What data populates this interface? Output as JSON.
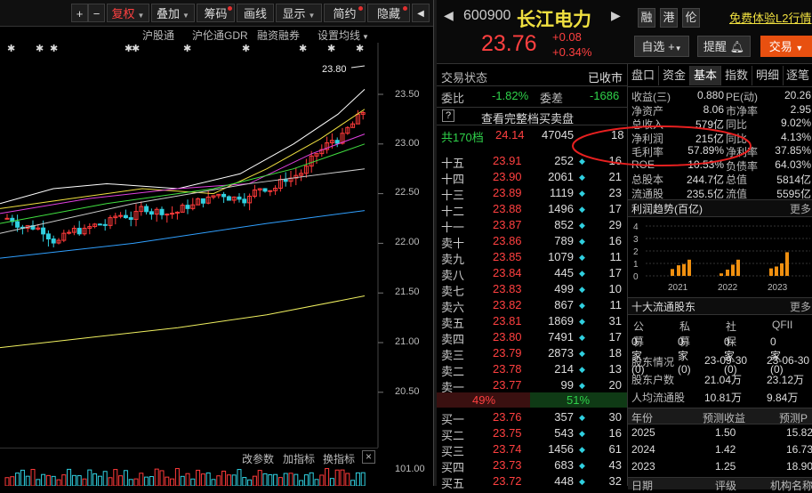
{
  "toolbar": {
    "items": [
      "+",
      "−",
      "复权",
      "叠加",
      "筹码",
      "画线",
      "显示",
      "简约",
      "隐藏"
    ],
    "close": "◀"
  },
  "subbar": {
    "items": [
      "沪股通",
      "沪伦通GDR",
      "融资融券",
      "设置均线"
    ]
  },
  "chart": {
    "price_labels": [
      "23.50",
      "23.00",
      "22.50",
      "22.00",
      "21.50",
      "21.00",
      "20.50"
    ],
    "high_label": "23.80",
    "vol_label": "101.00",
    "colors": {
      "up": "#ff3a3a",
      "down": "#30d0e0",
      "ma5": "#ffffff",
      "ma10": "#f0e040",
      "ma20": "#e040e0",
      "ma30": "#40e040",
      "ma60": "#30a0ff",
      "ma120": "#f0f060"
    }
  },
  "botbar": {
    "items": [
      "改参数",
      "加指标",
      "换指标"
    ],
    "close": "×"
  },
  "stock": {
    "code": "600900",
    "name": "长江电力",
    "price": "23.76",
    "change": "+0.08",
    "change_pct": "+0.34%",
    "tags": [
      "融",
      "港",
      "伦"
    ],
    "promo": "免费体验L2行情",
    "btn_watch": "自选",
    "btn_alert": "提醒",
    "btn_trade": "交易"
  },
  "orderbook": {
    "status_label": "交易状态",
    "status_value": "已收市",
    "wb_label": "委比",
    "wb_value": "-1.82%",
    "wc_label": "委差",
    "wc_value": "-1686",
    "help": "?",
    "full_depth": "查看完整档买卖盘",
    "total_label": "共170档",
    "total_price": "24.14",
    "total_vol": "47045",
    "total_cnt": "18",
    "asks": [
      {
        "label": "十五",
        "price": "23.91",
        "vol": "252",
        "cnt": "16"
      },
      {
        "label": "十四",
        "price": "23.90",
        "vol": "2061",
        "cnt": "21"
      },
      {
        "label": "十三",
        "price": "23.89",
        "vol": "1119",
        "cnt": "23"
      },
      {
        "label": "十二",
        "price": "23.88",
        "vol": "1496",
        "cnt": "17"
      },
      {
        "label": "十一",
        "price": "23.87",
        "vol": "852",
        "cnt": "29"
      },
      {
        "label": "卖十",
        "price": "23.86",
        "vol": "789",
        "cnt": "16"
      },
      {
        "label": "卖九",
        "price": "23.85",
        "vol": "1079",
        "cnt": "11"
      },
      {
        "label": "卖八",
        "price": "23.84",
        "vol": "445",
        "cnt": "17"
      },
      {
        "label": "卖七",
        "price": "23.83",
        "vol": "499",
        "cnt": "10"
      },
      {
        "label": "卖六",
        "price": "23.82",
        "vol": "867",
        "cnt": "11"
      },
      {
        "label": "卖五",
        "price": "23.81",
        "vol": "1869",
        "cnt": "31"
      },
      {
        "label": "卖四",
        "price": "23.80",
        "vol": "7491",
        "cnt": "17"
      },
      {
        "label": "卖三",
        "price": "23.79",
        "vol": "2873",
        "cnt": "18"
      },
      {
        "label": "卖二",
        "price": "23.78",
        "vol": "214",
        "cnt": "13"
      },
      {
        "label": "卖一",
        "price": "23.77",
        "vol": "99",
        "cnt": "20"
      }
    ],
    "sell_pct": "49%",
    "buy_pct": "51%",
    "buy_fraction": 0.51,
    "bids": [
      {
        "label": "买一",
        "price": "23.76",
        "vol": "357",
        "cnt": "30"
      },
      {
        "label": "买二",
        "price": "23.75",
        "vol": "543",
        "cnt": "16"
      },
      {
        "label": "买三",
        "price": "23.74",
        "vol": "1456",
        "cnt": "61"
      },
      {
        "label": "买四",
        "price": "23.73",
        "vol": "683",
        "cnt": "43"
      },
      {
        "label": "买五",
        "price": "23.72",
        "vol": "448",
        "cnt": "32"
      }
    ]
  },
  "fundamentals": {
    "tabs": [
      "盘口",
      "资金",
      "基本",
      "指数",
      "明细",
      "逐笔"
    ],
    "metrics": [
      {
        "l1": "收益(三)",
        "v1": "0.880",
        "l2": "PE(动)",
        "v2": "20.26"
      },
      {
        "l1": "净资产",
        "v1": "8.06",
        "l2": "市净率",
        "v2": "2.95"
      },
      {
        "l1": "总收入",
        "v1": "579亿",
        "l2": "同比",
        "v2": "9.02%"
      },
      {
        "l1": "净利润",
        "v1": "215亿",
        "l2": "同比",
        "v2": "4.13%"
      },
      {
        "l1": "毛利率",
        "v1": "57.89%",
        "l2": "净利率",
        "v2": "37.85%"
      },
      {
        "l1": "ROE",
        "v1": "10.53%",
        "l2": "负债率",
        "v2": "64.03%"
      },
      {
        "l1": "总股本",
        "v1": "244.7亿",
        "l2": "总值",
        "v2": "5814亿"
      },
      {
        "l1": "流通股",
        "v1": "235.5亿",
        "l2": "流值",
        "v2": "5595亿"
      }
    ],
    "profit_title": "利润趋势(百亿)",
    "more": "更多",
    "profit_chart": {
      "y_ticks": [
        "4",
        "3",
        "2",
        "1",
        "0"
      ],
      "years": [
        "2021",
        "2022",
        "2023"
      ],
      "bars": [
        0.55,
        0.85,
        0.95,
        1.3,
        0.2,
        0.5,
        0.9,
        1.3,
        0.6,
        0.75,
        1.0,
        1.9
      ]
    },
    "holders_title": "十大流通股东",
    "holders_cols": [
      "公募",
      "私募",
      "社保",
      "QFII"
    ],
    "holders_vals": [
      "0家(0)",
      "0家(0)",
      "0家(0)",
      "0家(0)"
    ],
    "holders_info": [
      {
        "label": "股东情况",
        "v1": "23-09-30",
        "v2": "23-06-30"
      },
      {
        "label": "股东户数",
        "v1": "21.04万",
        "v2": "23.12万"
      },
      {
        "label": "人均流通股",
        "v1": "10.81万",
        "v2": "9.84万"
      }
    ],
    "forecast_cols": [
      "年份",
      "预测收益",
      "预测P"
    ],
    "forecast_rows": [
      {
        "year": "2025",
        "eps": "1.50",
        "pe": "15.82"
      },
      {
        "year": "2024",
        "eps": "1.42",
        "pe": "16.73"
      },
      {
        "year": "2023",
        "eps": "1.25",
        "pe": "18.90"
      }
    ],
    "footer_cols": [
      "日期",
      "评级",
      "机构名称"
    ]
  }
}
